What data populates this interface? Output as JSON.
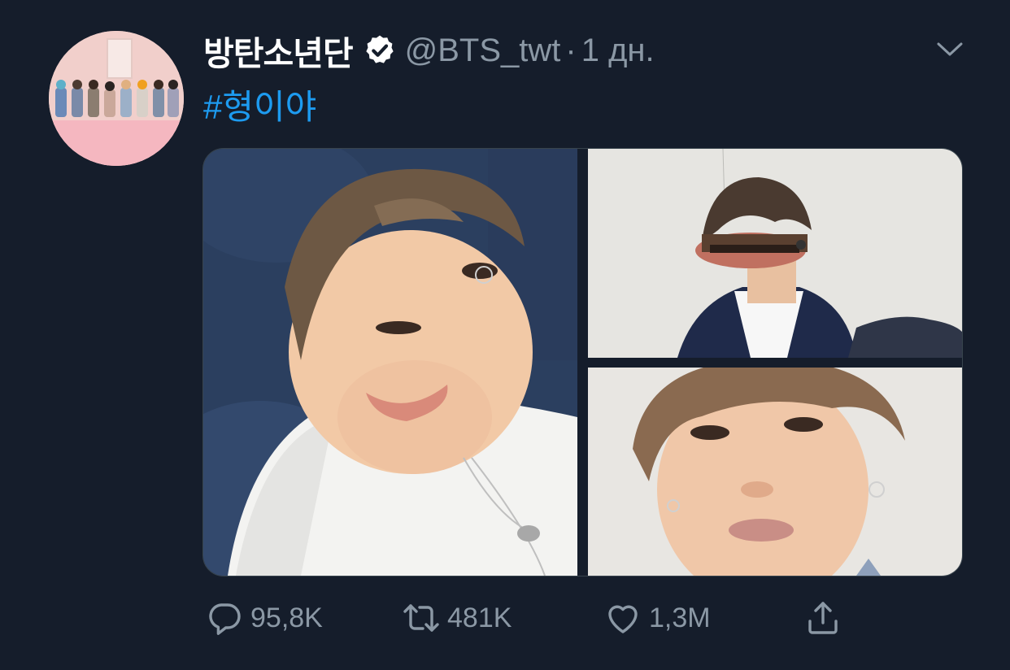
{
  "tweet": {
    "author_name": "방탄소년단",
    "handle": "@BTS_twt",
    "separator": "·",
    "time": "1 дн.",
    "text": "#형이야",
    "verified": true
  },
  "actions": {
    "reply_count": "95,8K",
    "retweet_count": "481K",
    "like_count": "1,3M"
  },
  "icons": {
    "verified": "verified-badge-icon",
    "more": "chevron-down-icon",
    "reply": "reply-icon",
    "retweet": "retweet-icon",
    "like": "heart-icon",
    "share": "share-icon"
  },
  "colors": {
    "background": "#151d2b",
    "link": "#1d9bf0",
    "muted": "#8b98a5",
    "text": "#ffffff"
  }
}
